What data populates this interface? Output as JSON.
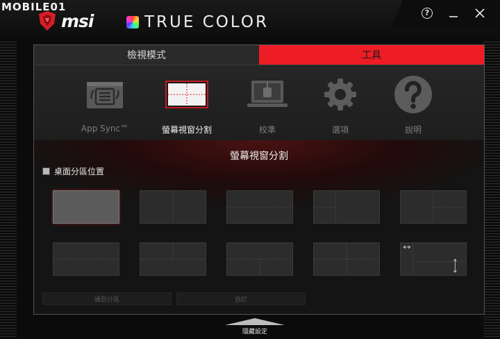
{
  "watermark": "MOBILE01",
  "brand": {
    "msi": "msi",
    "product": "TRUE COLOR"
  },
  "window_controls": {
    "help": "?",
    "minimize": "—",
    "close": "✕"
  },
  "tabs": [
    {
      "label": "檢視模式",
      "active": false
    },
    {
      "label": "工具",
      "active": true
    }
  ],
  "tools": [
    {
      "label": "App Sync™",
      "icon": "app-sync-icon",
      "active": false
    },
    {
      "label": "螢幕視窗分割",
      "icon": "screen-split-icon",
      "active": true
    },
    {
      "label": "校準",
      "icon": "calibration-icon",
      "active": false
    },
    {
      "label": "選項",
      "icon": "gear-icon",
      "active": false
    },
    {
      "label": "說明",
      "icon": "question-icon",
      "active": false
    }
  ],
  "content": {
    "title": "螢幕視窗分割",
    "checkbox_label": "桌面分區位置"
  },
  "buttons": {
    "identify": "識別分區",
    "custom": "自訂"
  },
  "hide_settings": "隱藏設定",
  "colors": {
    "accent": "#ee1c24",
    "panel": "#1c1c1c"
  }
}
